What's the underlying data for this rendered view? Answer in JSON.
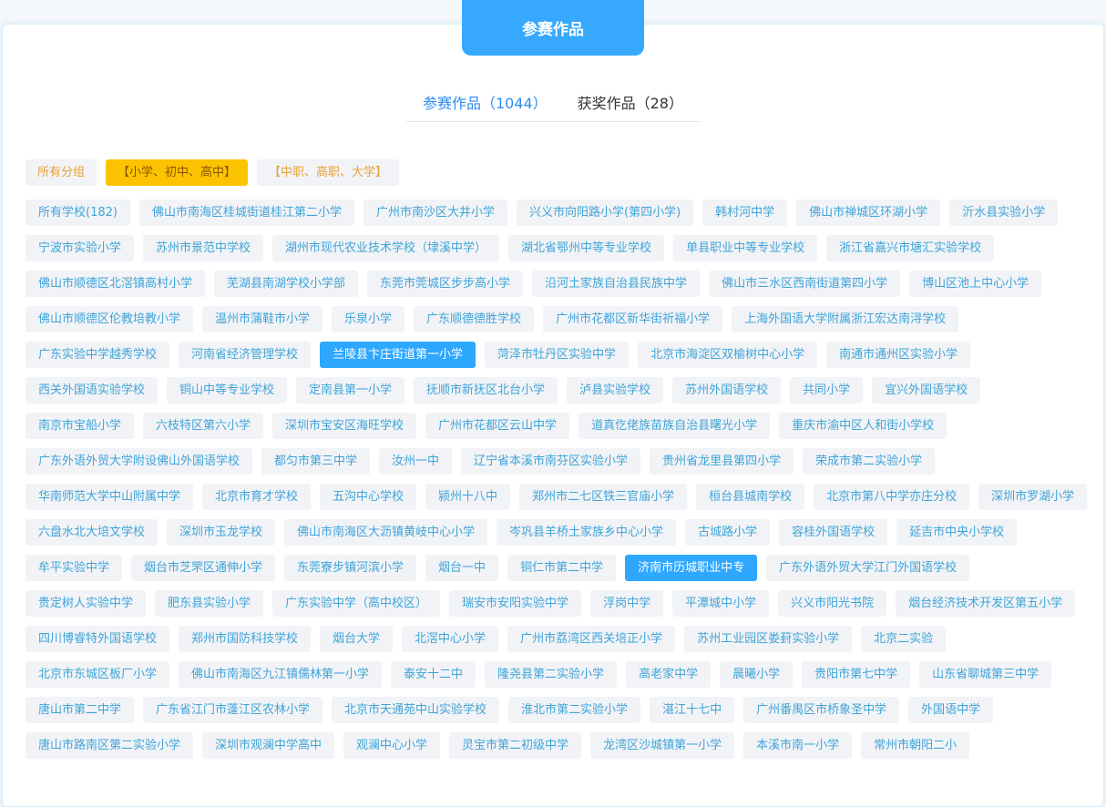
{
  "header": {
    "title": "参赛作品"
  },
  "tabs": [
    {
      "label": "参赛作品（1044）",
      "active": true
    },
    {
      "label": "获奖作品（28）",
      "active": false
    }
  ],
  "categories": [
    {
      "label": "所有分组",
      "active": false
    },
    {
      "label": "【小学、初中、高中】",
      "active": true
    },
    {
      "label": "【中职、高职、大学】",
      "active": false
    }
  ],
  "schools": [
    {
      "label": "所有学校(182)"
    },
    {
      "label": "佛山市南海区桂城街道桂江第二小学"
    },
    {
      "label": "广州市南沙区大井小学"
    },
    {
      "label": "兴义市向阳路小学(第四小学)"
    },
    {
      "label": "韩村河中学"
    },
    {
      "label": "佛山市禅城区环湖小学"
    },
    {
      "label": "沂水县实验小学"
    },
    {
      "label": "宁波市实验小学"
    },
    {
      "label": "苏州市景范中学校"
    },
    {
      "label": "湖州市现代农业技术学校（埭溪中学）"
    },
    {
      "label": "湖北省鄂州中等专业学校"
    },
    {
      "label": "单县职业中等专业学校"
    },
    {
      "label": "浙江省嘉兴市塘汇实验学校"
    },
    {
      "label": "佛山市顺德区北滘镇高村小学"
    },
    {
      "label": "芜湖县南湖学校小学部"
    },
    {
      "label": "东莞市莞城区步步高小学"
    },
    {
      "label": "沿河土家族自治县民族中学"
    },
    {
      "label": "佛山市三水区西南街道第四小学"
    },
    {
      "label": "博山区池上中心小学"
    },
    {
      "label": "佛山市顺德区伦教培教小学"
    },
    {
      "label": "温州市蒲鞋市小学"
    },
    {
      "label": "乐泉小学"
    },
    {
      "label": "广东顺德德胜学校"
    },
    {
      "label": "广州市花都区新华街祈福小学"
    },
    {
      "label": "上海外国语大学附属浙江宏达南浔学校"
    },
    {
      "label": "广东实验中学越秀学校"
    },
    {
      "label": "河南省经济管理学校"
    },
    {
      "label": "兰陵县卞庄街道第一小学",
      "active": true
    },
    {
      "label": "菏泽市牡丹区实验中学"
    },
    {
      "label": "北京市海淀区双榆树中心小学"
    },
    {
      "label": "南通市通州区实验小学"
    },
    {
      "label": "西关外国语实验学校"
    },
    {
      "label": "铜山中等专业学校"
    },
    {
      "label": "定南县第一小学"
    },
    {
      "label": "抚顺市新抚区北台小学"
    },
    {
      "label": "泸县实验学校"
    },
    {
      "label": "苏州外国语学校"
    },
    {
      "label": "共同小学"
    },
    {
      "label": "宜兴外国语学校"
    },
    {
      "label": "南京市宝船小学"
    },
    {
      "label": "六枝特区第六小学"
    },
    {
      "label": "深圳市宝安区海旺学校"
    },
    {
      "label": "广州市花都区云山中学"
    },
    {
      "label": "道真仡佬族苗族自治县曙光小学"
    },
    {
      "label": "重庆市渝中区人和街小学校"
    },
    {
      "label": "广东外语外贸大学附设佛山外国语学校"
    },
    {
      "label": "都匀市第三中学"
    },
    {
      "label": "汝州一中"
    },
    {
      "label": "辽宁省本溪市南芬区实验小学"
    },
    {
      "label": "贵州省龙里县第四小学"
    },
    {
      "label": "荣成市第二实验小学"
    },
    {
      "label": "华南师范大学中山附属中学"
    },
    {
      "label": "北京市育才学校"
    },
    {
      "label": "五沟中心学校"
    },
    {
      "label": "颍州十八中"
    },
    {
      "label": "郑州市二七区铁三官庙小学"
    },
    {
      "label": "桓台县城南学校"
    },
    {
      "label": "北京市第八中学亦庄分校"
    },
    {
      "label": "深圳市罗湖小学"
    },
    {
      "label": "六盘水北大培文学校"
    },
    {
      "label": "深圳市玉龙学校"
    },
    {
      "label": "佛山市南海区大沥镇黄岐中心小学"
    },
    {
      "label": "岑巩县羊桥土家族乡中心小学"
    },
    {
      "label": "古城路小学"
    },
    {
      "label": "容桂外国语学校"
    },
    {
      "label": "延吉市中央小学校"
    },
    {
      "label": "牟平实验中学"
    },
    {
      "label": "烟台市芝罘区通伸小学"
    },
    {
      "label": "东莞寮步镇河滨小学"
    },
    {
      "label": "烟台一中"
    },
    {
      "label": "铜仁市第二中学"
    },
    {
      "label": "济南市历城职业中专",
      "active": true
    },
    {
      "label": "广东外语外贸大学江门外国语学校"
    },
    {
      "label": "贵定树人实验中学"
    },
    {
      "label": "肥东县实验小学"
    },
    {
      "label": "广东实验中学（高中校区）"
    },
    {
      "label": "瑞安市安阳实验中学"
    },
    {
      "label": "浮岗中学"
    },
    {
      "label": "平潭城中小学"
    },
    {
      "label": "兴义市阳光书院"
    },
    {
      "label": "烟台经济技术开发区第五小学"
    },
    {
      "label": "四川博睿特外国语学校"
    },
    {
      "label": "郑州市国防科技学校"
    },
    {
      "label": "烟台大学"
    },
    {
      "label": "北滘中心小学"
    },
    {
      "label": "广州市荔湾区西关培正小学"
    },
    {
      "label": "苏州工业园区娄葑实验小学"
    },
    {
      "label": "北京二实验"
    },
    {
      "label": "北京市东城区板厂小学"
    },
    {
      "label": "佛山市南海区九江镇儒林第一小学"
    },
    {
      "label": "泰安十二中"
    },
    {
      "label": "隆尧县第二实验小学"
    },
    {
      "label": "高老家中学"
    },
    {
      "label": "晨曦小学"
    },
    {
      "label": "贵阳市第七中学"
    },
    {
      "label": "山东省聊城第三中学"
    },
    {
      "label": "唐山市第二中学"
    },
    {
      "label": "广东省江门市蓬江区农林小学"
    },
    {
      "label": "北京市天通苑中山实验学校"
    },
    {
      "label": "淮北市第二实验小学"
    },
    {
      "label": "湛江十七中"
    },
    {
      "label": "广州番禺区市桥象圣中学"
    },
    {
      "label": "外国语中学"
    },
    {
      "label": "唐山市路南区第二实验小学"
    },
    {
      "label": "深圳市观澜中学高中"
    },
    {
      "label": "观澜中心小学"
    },
    {
      "label": "灵宝市第二初级中学"
    },
    {
      "label": "龙湾区沙城镇第一小学"
    },
    {
      "label": "本溪市南一小学"
    },
    {
      "label": "常州市朝阳二小"
    }
  ]
}
